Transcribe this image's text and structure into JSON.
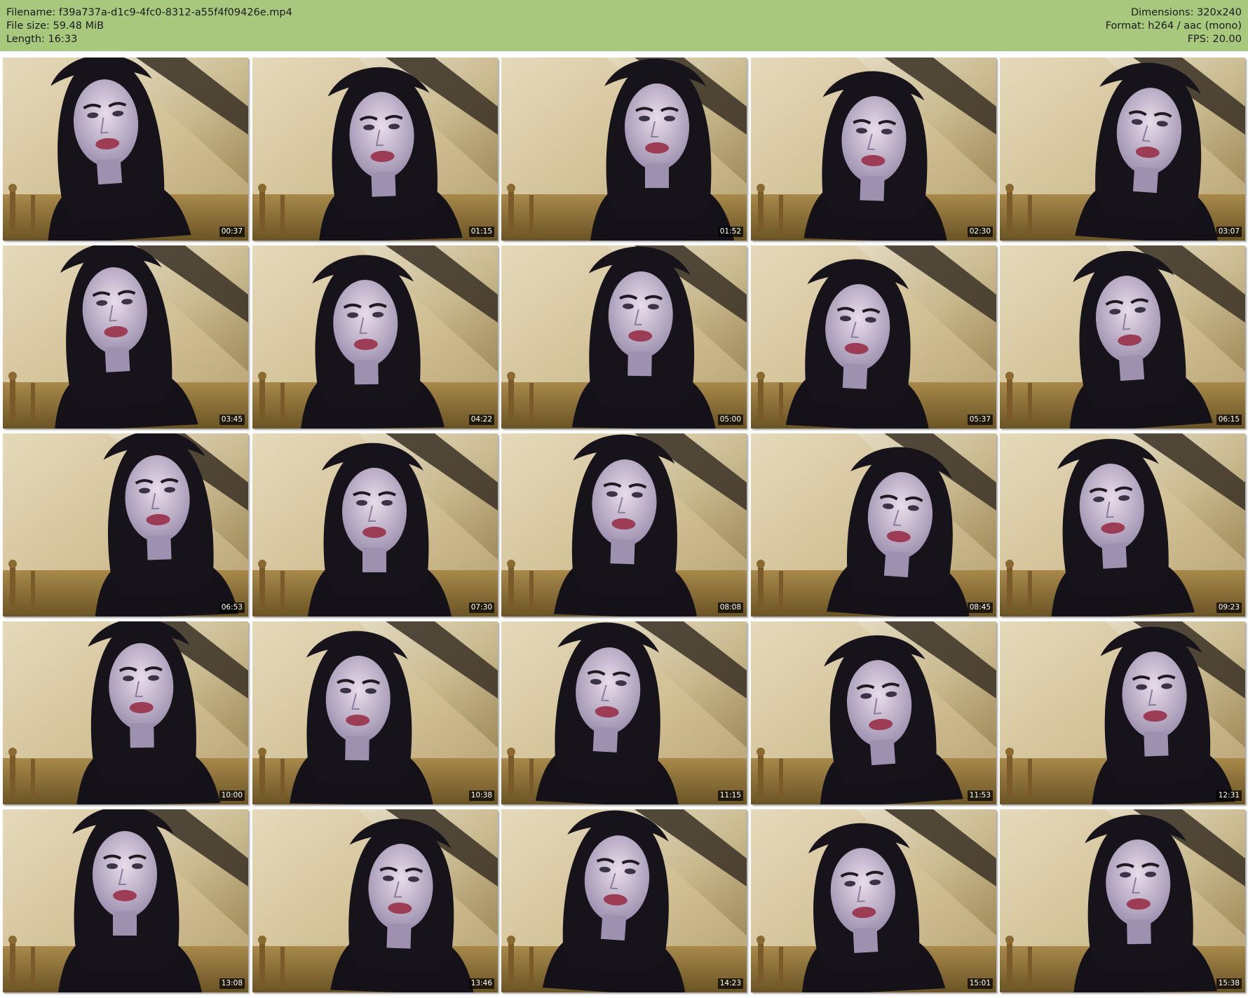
{
  "header": {
    "filename_label": "Filename:",
    "filename": "f39a737a-d1c9-4fc0-8312-a55f4f09426e.mp4",
    "filesize_label": "File size:",
    "filesize": "59.48 MiB",
    "length_label": "Length:",
    "length": "16:33",
    "dimensions_label": "Dimensions:",
    "dimensions": "320x240",
    "format_label": "Format:",
    "format": "h264 / aac (mono)",
    "fps_label": "FPS:",
    "fps": "20.00"
  },
  "colors": {
    "header_bg": "#a8c87e",
    "page_bg": "#ffffff",
    "timestamp_bg": "#000000",
    "timestamp_text": "#ffffff"
  },
  "thumbnails": [
    {
      "timestamp": "00:37"
    },
    {
      "timestamp": "01:15"
    },
    {
      "timestamp": "01:52"
    },
    {
      "timestamp": "02:30"
    },
    {
      "timestamp": "03:07"
    },
    {
      "timestamp": "03:45"
    },
    {
      "timestamp": "04:22"
    },
    {
      "timestamp": "05:00"
    },
    {
      "timestamp": "05:37"
    },
    {
      "timestamp": "06:15"
    },
    {
      "timestamp": "06:53"
    },
    {
      "timestamp": "07:30"
    },
    {
      "timestamp": "08:08"
    },
    {
      "timestamp": "08:45"
    },
    {
      "timestamp": "09:23"
    },
    {
      "timestamp": "10:00"
    },
    {
      "timestamp": "10:38"
    },
    {
      "timestamp": "11:15"
    },
    {
      "timestamp": "11:53"
    },
    {
      "timestamp": "12:31"
    },
    {
      "timestamp": "13:08"
    },
    {
      "timestamp": "13:46"
    },
    {
      "timestamp": "14:23"
    },
    {
      "timestamp": "15:01"
    },
    {
      "timestamp": "15:38"
    }
  ]
}
